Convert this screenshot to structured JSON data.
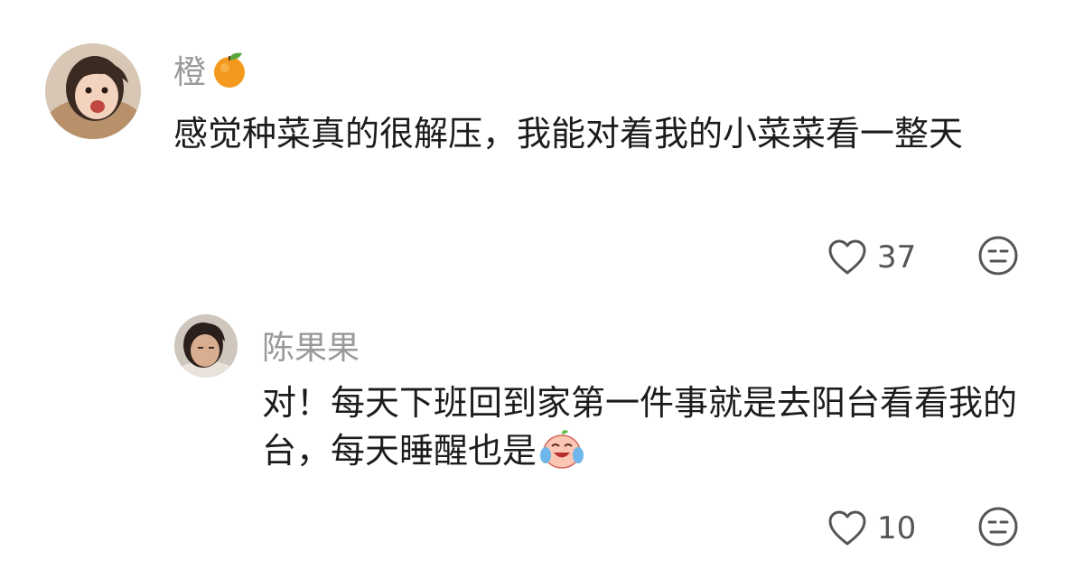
{
  "comments": [
    {
      "username": "橙",
      "username_emoji_icon": "tangerine-icon",
      "text": "感觉种菜真的很解压，我能对着我的小菜菜看一整天",
      "like_count": "37",
      "reply": {
        "username": "陈果果",
        "text": "对！每天下班回到家第一件事就是去阳台看看我的台，每天睡醒也是",
        "text_emoji_icon": "laughing-crying-face-icon",
        "like_count": "10"
      }
    }
  ],
  "icons": {
    "like": "heart-outline-icon",
    "react": "meh-face-icon"
  }
}
